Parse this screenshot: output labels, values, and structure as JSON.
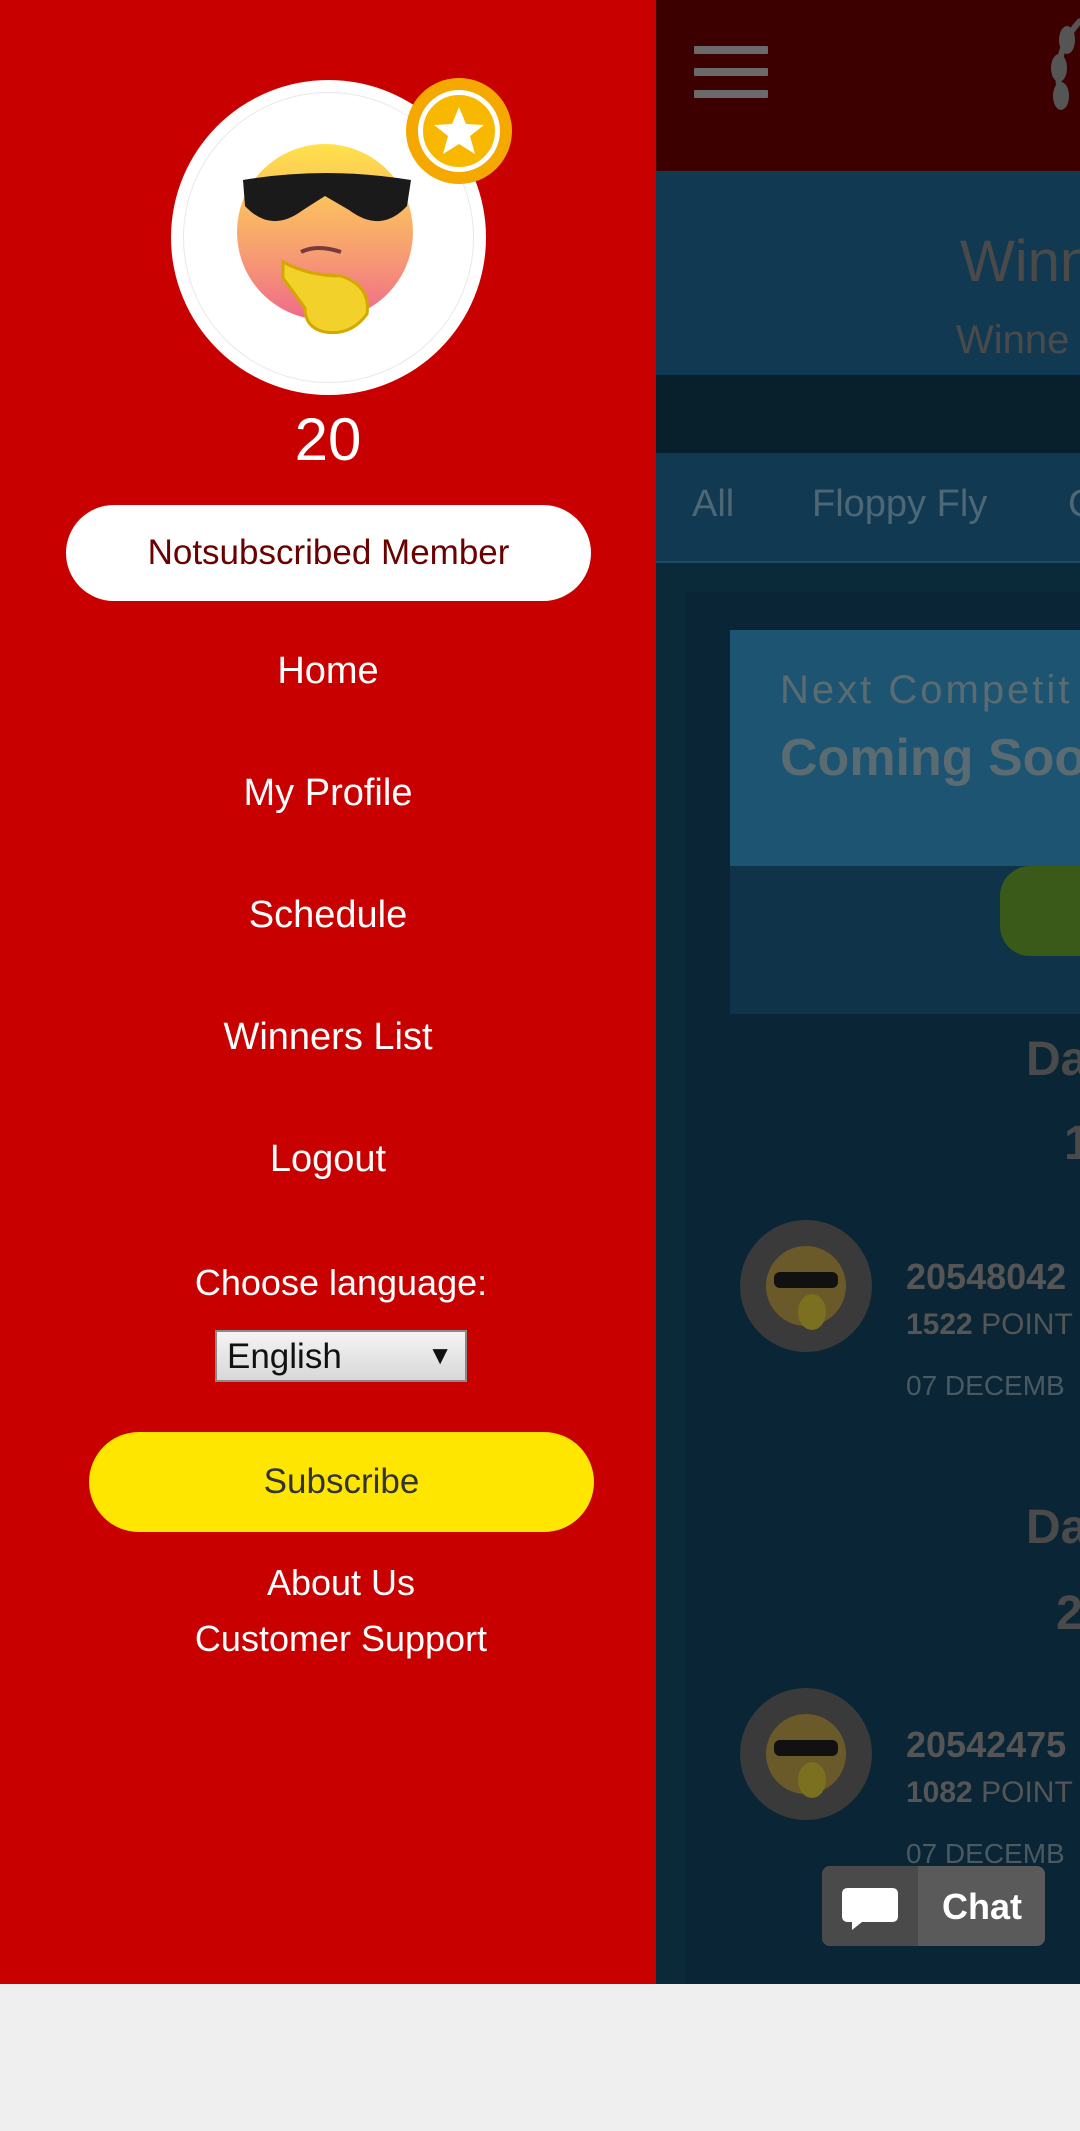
{
  "background_page": {
    "hero": {
      "title": "Winn",
      "subtitle": "Winne"
    },
    "tabs": [
      {
        "label": "All"
      },
      {
        "label": "Floppy Fly"
      },
      {
        "label": "C"
      }
    ],
    "banner": {
      "label": "Next Competit",
      "title": "Coming Soo"
    },
    "day_sections": [
      {
        "heading": "Da",
        "subheading": "1",
        "player_id": "20548042",
        "points_value": "1522",
        "points_label": "POINT",
        "date": "07 DECEMB"
      },
      {
        "heading": "Da",
        "subheading": "2",
        "player_id": "20542475",
        "points_value": "1082",
        "points_label": "POINT",
        "date": "07 DECEMB"
      }
    ]
  },
  "drawer": {
    "level": "20",
    "member_status": "Notsubscribed Member",
    "nav": [
      {
        "label": "Home"
      },
      {
        "label": "My Profile"
      },
      {
        "label": "Schedule"
      },
      {
        "label": "Winners List"
      },
      {
        "label": "Logout"
      }
    ],
    "language": {
      "label": "Choose language:",
      "selected": "English"
    },
    "subscribe_label": "Subscribe",
    "footer": {
      "about": "About Us",
      "support": "Customer Support"
    }
  },
  "chat": {
    "label": "Chat"
  },
  "icons": [
    "hamburger-icon",
    "laurel-icon",
    "star-badge-icon",
    "cool-emoji-avatar-icon",
    "chevron-down-icon",
    "chat-bubble-icon"
  ],
  "colors": {
    "drawer_bg": "#c80000",
    "subscribe_bg": "#ffe600",
    "badge": "#f5a800",
    "dimmed_page": "#0a2a3a"
  }
}
